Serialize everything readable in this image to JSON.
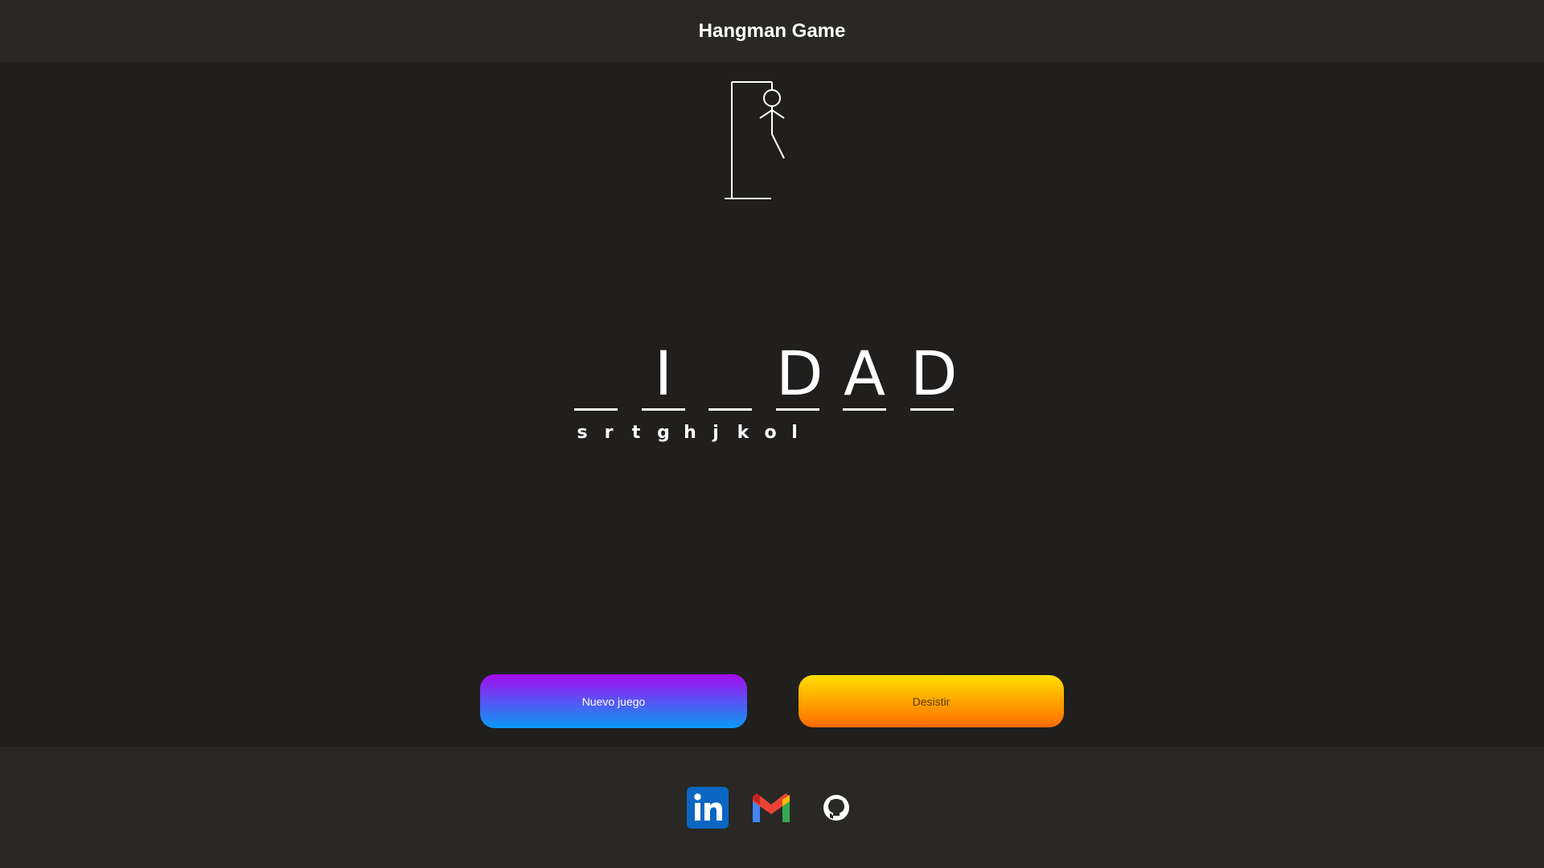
{
  "header": {
    "title": "Hangman Game"
  },
  "game": {
    "word_slots": [
      "",
      "I",
      "",
      "D",
      "A",
      "D"
    ],
    "wrong_letters": [
      "s",
      "r",
      "t",
      "g",
      "h",
      "j",
      "k",
      "o",
      "l"
    ],
    "hangman_parts_drawn": [
      "head",
      "body",
      "left-arm",
      "right-arm",
      "right-leg"
    ]
  },
  "buttons": {
    "new_game_label": "Nuevo juego",
    "quit_label": "Desistir"
  },
  "footer": {
    "links": [
      {
        "name": "linkedin-icon",
        "label": "in"
      },
      {
        "name": "gmail-icon"
      },
      {
        "name": "github-icon"
      }
    ]
  },
  "colors": {
    "background": "#201f1d",
    "bar": "#292825",
    "new_game_gradient": [
      "#a50cf0",
      "#0a9bf5"
    ],
    "quit_gradient": [
      "#ffe000",
      "#ff6a00"
    ]
  }
}
